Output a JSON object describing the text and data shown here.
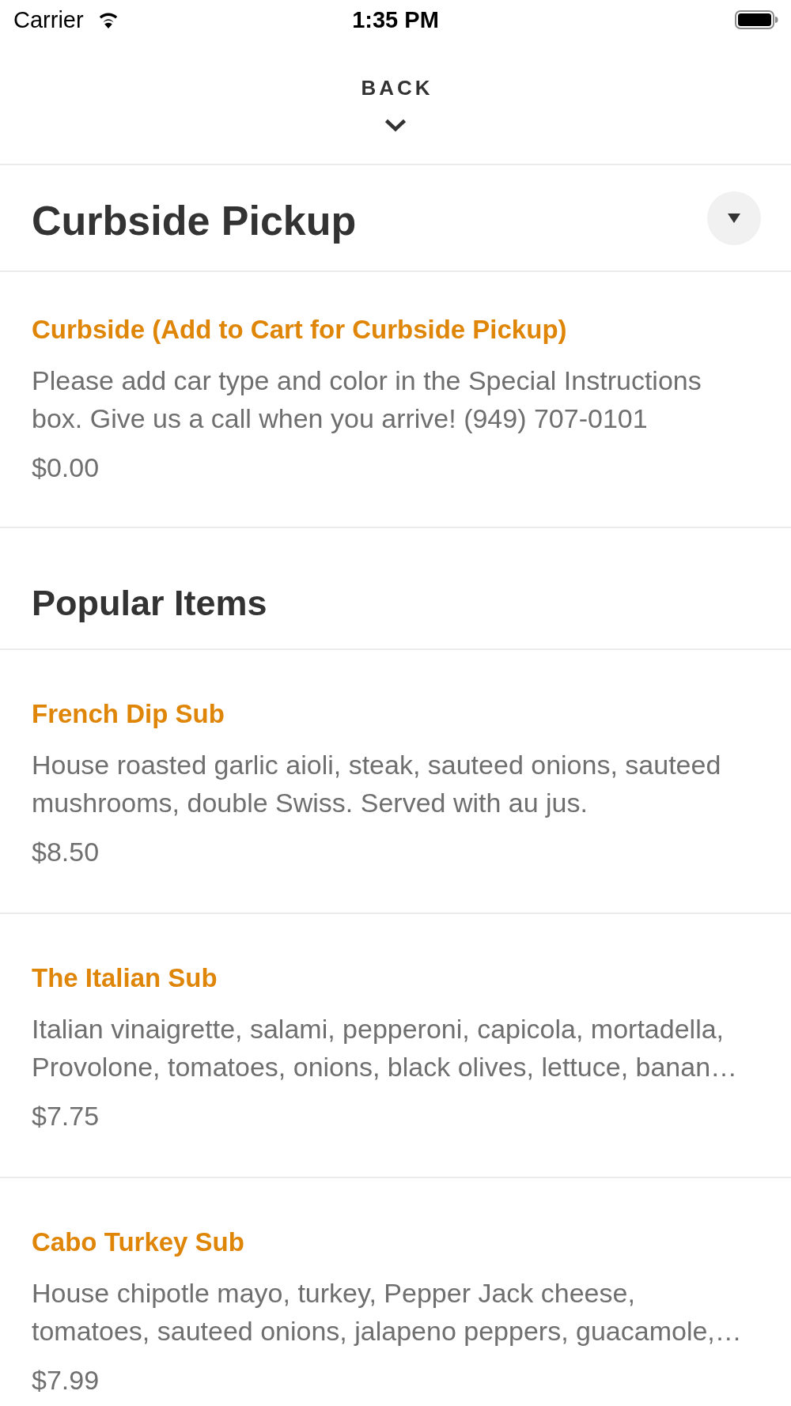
{
  "status_bar": {
    "carrier": "Carrier",
    "time": "1:35 PM"
  },
  "header": {
    "back_label": "BACK"
  },
  "sections": [
    {
      "kind": "collapsible",
      "title": "Curbside Pickup",
      "items": [
        {
          "name": "Curbside (Add to Cart for Curbside Pickup)",
          "description": "Please add car type and color in the Special Instructions box. Give us a call when you arrive! (949) 707-0101",
          "price": "$0.00"
        }
      ]
    },
    {
      "kind": "list",
      "title": "Popular Items",
      "items": [
        {
          "name": "French Dip Sub",
          "description": "House roasted garlic aioli, steak, sauteed onions, sauteed mushrooms, double Swiss. Served with au jus.",
          "price": "$8.50"
        },
        {
          "name": "The Italian Sub",
          "description": "Italian vinaigrette, salami, pepperoni, capicola, mortadella, Provolone, tomatoes, onions, black olives, lettuce, banan…",
          "price": "$7.75"
        },
        {
          "name": "Cabo Turkey Sub",
          "description": "House chipotle mayo, turkey, Pepper Jack cheese, tomatoes, sauteed onions, jalapeno peppers, guacamole,…",
          "price": "$7.99"
        }
      ]
    }
  ]
}
